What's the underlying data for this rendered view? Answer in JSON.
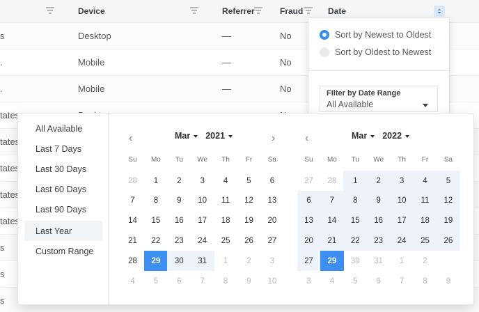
{
  "table": {
    "columns": [
      "Device",
      "Referrer",
      "Fraud",
      "Date"
    ],
    "rows": [
      {
        "left": "s",
        "device": "Desktop",
        "referrer": "—",
        "fraud": "No"
      },
      {
        "left": ".",
        "device": "Mobile",
        "referrer": "—",
        "fraud": "No"
      },
      {
        "left": ".",
        "device": "Mobile",
        "referrer": "—",
        "fraud": "No"
      },
      {
        "left": "tates",
        "device": "Desktop",
        "referrer": "",
        "fraud": "No"
      },
      {
        "left": "tates",
        "device": "",
        "referrer": "",
        "fraud": ""
      },
      {
        "left": "tates",
        "device": "",
        "referrer": "",
        "fraud": ""
      },
      {
        "left": "tates",
        "device": "",
        "referrer": "",
        "fraud": ""
      },
      {
        "left": "tates",
        "device": "",
        "referrer": "",
        "fraud": ""
      },
      {
        "left": "s",
        "device": "",
        "referrer": "",
        "fraud": ""
      },
      {
        "left": "s",
        "device": "",
        "referrer": "",
        "fraud": ""
      },
      {
        "left": "s",
        "device": "",
        "referrer": "",
        "fraud": ""
      }
    ]
  },
  "sort_menu": {
    "options": [
      {
        "label": "Sort by Newest to Oldest",
        "selected": true
      },
      {
        "label": "Sort by Oldest to Newest",
        "selected": false
      }
    ],
    "filter_label": "Filter by Date Range",
    "filter_value": "All Available"
  },
  "picker": {
    "presets": [
      "All Available",
      "Last 7 Days",
      "Last 30 Days",
      "Last 60 Days",
      "Last 90 Days",
      "Last Year",
      "Custom Range"
    ],
    "active_preset": "Last Year",
    "weekdays": [
      "Su",
      "Mo",
      "Tu",
      "We",
      "Th",
      "Fr",
      "Sa"
    ],
    "left": {
      "month": "Mar",
      "year": "2021",
      "weeks": [
        [
          "28",
          "1",
          "2",
          "3",
          "4",
          "5",
          "6"
        ],
        [
          "7",
          "8",
          "9",
          "10",
          "11",
          "12",
          "13"
        ],
        [
          "14",
          "15",
          "16",
          "17",
          "18",
          "19",
          "20"
        ],
        [
          "21",
          "22",
          "23",
          "24",
          "25",
          "26",
          "27"
        ],
        [
          "28",
          "29",
          "30",
          "31",
          "1",
          "2",
          "3"
        ],
        [
          "4",
          "5",
          "6",
          "7",
          "8",
          "9",
          "10"
        ]
      ]
    },
    "right": {
      "month": "Mar",
      "year": "2022",
      "weeks": [
        [
          "27",
          "28",
          "1",
          "2",
          "3",
          "4",
          "5"
        ],
        [
          "6",
          "7",
          "8",
          "9",
          "10",
          "11",
          "12"
        ],
        [
          "13",
          "14",
          "15",
          "16",
          "17",
          "18",
          "19"
        ],
        [
          "20",
          "21",
          "22",
          "23",
          "24",
          "25",
          "26"
        ],
        [
          "27",
          "29",
          "30",
          "31",
          "1",
          "2"
        ],
        [
          "3",
          "4",
          "5",
          "6",
          "7",
          "8",
          "9"
        ]
      ]
    }
  }
}
